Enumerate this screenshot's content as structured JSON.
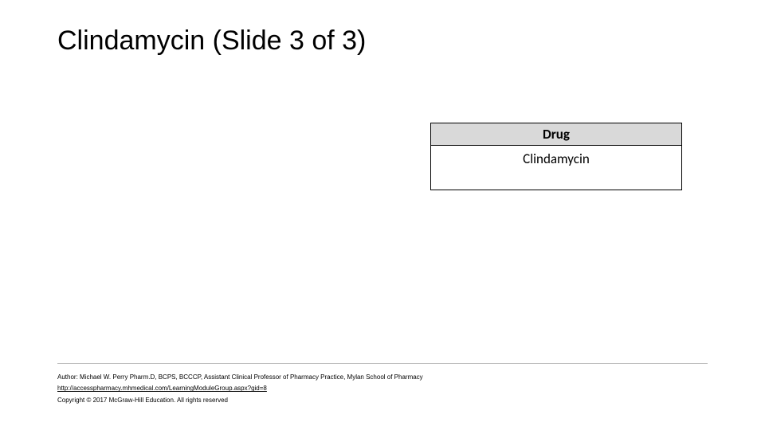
{
  "title": "Clindamycin  (Slide 3 of 3)",
  "table": {
    "header": "Drug",
    "row1": "Clindamycin"
  },
  "footer": {
    "author": "Author: Michael W. Perry Pharm.D, BCPS, BCCCP, Assistant Clinical Professor of Pharmacy Practice, Mylan School of Pharmacy",
    "link": "http://accesspharmacy.mhmedical.com/LearningModuleGroup.aspx?gid=8",
    "copyright": "Copyright © 2017 McGraw-Hill Education. All rights reserved"
  }
}
